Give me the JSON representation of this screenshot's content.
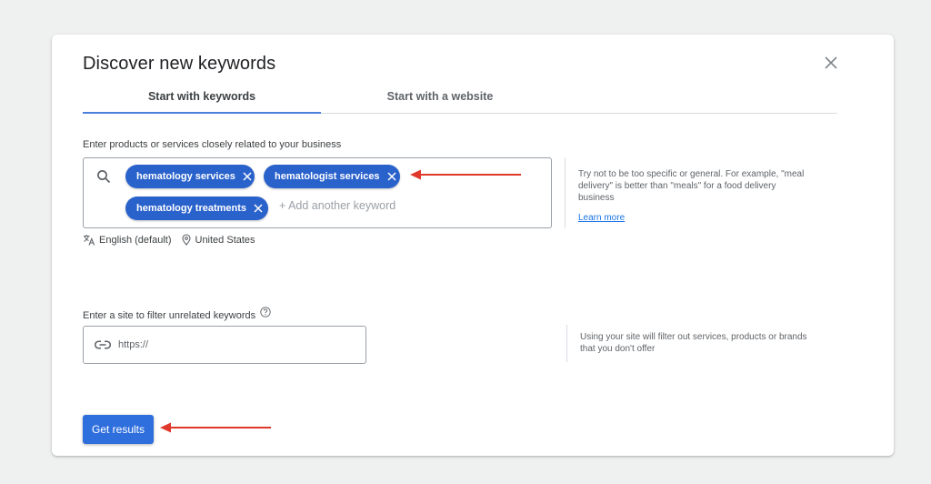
{
  "dialog": {
    "title": "Discover new keywords",
    "close_icon": "close-icon"
  },
  "tabs": [
    {
      "label": "Start with keywords",
      "active": true
    },
    {
      "label": "Start with a website",
      "active": false
    }
  ],
  "keywords_section": {
    "label": "Enter products or services closely related to your business",
    "search_icon": "search-icon",
    "chips": [
      {
        "label": "hematology services"
      },
      {
        "label": "hematologist services"
      },
      {
        "label": "hematology treatments"
      }
    ],
    "add_placeholder": "+ Add another keyword",
    "language": "English (default)",
    "location": "United States",
    "help_text": "Try not to be too specific or general. For example, \"meal delivery\" is better than \"meals\" for a food delivery business",
    "learn_more": "Learn more"
  },
  "site_section": {
    "label": "Enter a site to filter unrelated keywords",
    "help_icon": "help-circle-icon",
    "input_value": "",
    "input_placeholder": "https://",
    "help_text": "Using your site will filter out services, products or brands that you don't offer"
  },
  "actions": {
    "get_results_label": "Get results"
  },
  "annotations": {
    "arrow_color": "#e0392b"
  },
  "colors": {
    "chip_bg": "#2a62cc",
    "primary_button": "#2f6fdd",
    "tab_indicator": "#4a7fdc",
    "link": "#1a73e8"
  }
}
